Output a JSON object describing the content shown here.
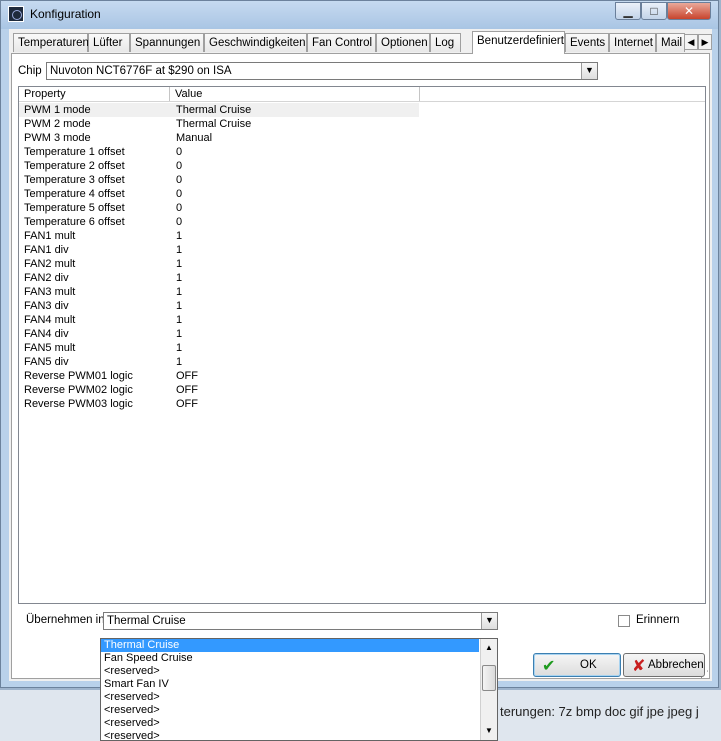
{
  "window": {
    "title": "Konfiguration",
    "min_glyph": "▁",
    "max_glyph": "□",
    "close_glyph": "✕"
  },
  "tabs": [
    {
      "label": "Temperaturen"
    },
    {
      "label": "Lüfter"
    },
    {
      "label": "Spannungen"
    },
    {
      "label": "Geschwindigkeiten"
    },
    {
      "label": "Fan Control"
    },
    {
      "label": "Optionen"
    },
    {
      "label": "Log"
    },
    {
      "label": "Benutzerdefiniert"
    },
    {
      "label": "Events"
    },
    {
      "label": "Internet"
    },
    {
      "label": "Mail"
    }
  ],
  "active_tab": "Benutzerdefiniert",
  "chip": {
    "label": "Chip",
    "value": "Nuvoton NCT6776F at $290 on ISA"
  },
  "grid": {
    "columns": [
      "Property",
      "Value"
    ],
    "rows": [
      {
        "property": "PWM 1 mode",
        "value": "Thermal Cruise"
      },
      {
        "property": "PWM 2 mode",
        "value": "Thermal Cruise"
      },
      {
        "property": "PWM 3 mode",
        "value": "Manual"
      },
      {
        "property": "Temperature 1 offset",
        "value": "0"
      },
      {
        "property": "Temperature 2 offset",
        "value": "0"
      },
      {
        "property": "Temperature 3 offset",
        "value": "0"
      },
      {
        "property": "Temperature 4 offset",
        "value": "0"
      },
      {
        "property": "Temperature 5 offset",
        "value": "0"
      },
      {
        "property": "Temperature 6 offset",
        "value": "0"
      },
      {
        "property": "FAN1 mult",
        "value": "1"
      },
      {
        "property": "FAN1 div",
        "value": "1"
      },
      {
        "property": "FAN2 mult",
        "value": "1"
      },
      {
        "property": "FAN2 div",
        "value": "1"
      },
      {
        "property": "FAN3 mult",
        "value": "1"
      },
      {
        "property": "FAN3 div",
        "value": "1"
      },
      {
        "property": "FAN4 mult",
        "value": "1"
      },
      {
        "property": "FAN4 div",
        "value": "1"
      },
      {
        "property": "FAN5 mult",
        "value": "1"
      },
      {
        "property": "FAN5 div",
        "value": "1"
      },
      {
        "property": "Reverse PWM01 logic",
        "value": "OFF"
      },
      {
        "property": "Reverse PWM02 logic",
        "value": "OFF"
      },
      {
        "property": "Reverse PWM03 logic",
        "value": "OFF"
      }
    ]
  },
  "apply": {
    "label": "Übernehmen in",
    "value": "Thermal Cruise",
    "options": [
      "Thermal Cruise",
      "Fan Speed Cruise",
      "<reserved>",
      "Smart Fan IV",
      "<reserved>",
      "<reserved>",
      "<reserved>",
      "<reserved>"
    ]
  },
  "remember": {
    "label": "Erinnern",
    "checked": false
  },
  "buttons": {
    "ok": "OK",
    "cancel": "Abbrechen"
  },
  "background_text": "terungen: 7z bmp doc gif jpe jpeg j",
  "colors": {
    "highlight": "#3399ff",
    "ok_icon": "#1e9a1e",
    "cancel_icon": "#c81e1e"
  }
}
